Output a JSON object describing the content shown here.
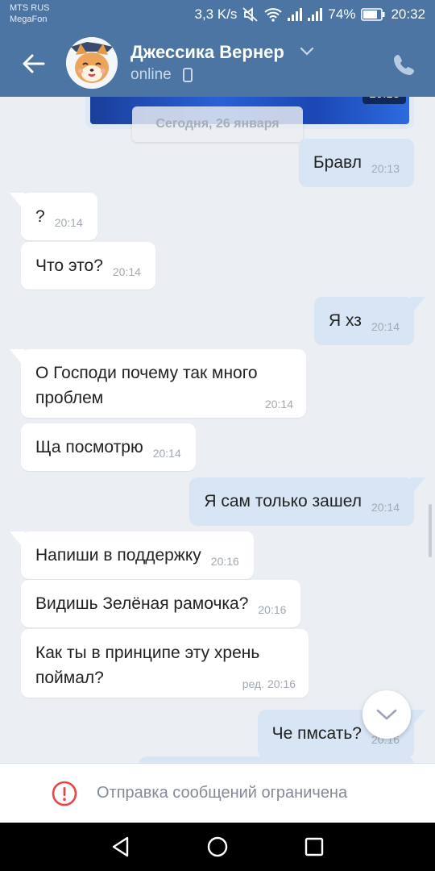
{
  "status_bar": {
    "carrier1": "MTS RUS",
    "carrier2": "MegaFon",
    "net_speed": "3,3 K/s",
    "battery": "74%",
    "time": "20:32"
  },
  "header": {
    "name": "Джессика Вернер",
    "status": "online",
    "icons": [
      "back-arrow-icon",
      "chevron-down-icon",
      "mobile-phone-icon",
      "phone-call-icon"
    ]
  },
  "chat": {
    "media_time": "20:13",
    "date_divider": "Сегодня, 26 января",
    "messages": [
      {
        "dir": "out",
        "text": "Бравл",
        "time": "20:13"
      },
      {
        "dir": "in",
        "text": "?",
        "time": "20:14"
      },
      {
        "dir": "in",
        "text": "Что это?",
        "time": "20:14"
      },
      {
        "dir": "out",
        "text": "Я хз",
        "time": "20:14"
      },
      {
        "dir": "in",
        "text": "О Господи почему так много проблем",
        "time": "20:14"
      },
      {
        "dir": "in",
        "text": "Ща посмотрю",
        "time": "20:14"
      },
      {
        "dir": "out",
        "text": "Я сам только зашел",
        "time": "20:14"
      },
      {
        "dir": "in",
        "text": "Напиши в поддержку",
        "time": "20:16"
      },
      {
        "dir": "in",
        "text": "Видишь Зелёная рамочка?",
        "time": "20:16"
      },
      {
        "dir": "in",
        "text": "Как ты в принципе эту хрень поймал?",
        "time": "ред. 20:16"
      },
      {
        "dir": "out",
        "text": "Че пмсать?",
        "time": "20:16"
      }
    ]
  },
  "footer": {
    "restriction_text": "Отправка сообщений ограничена"
  },
  "colors": {
    "header_bg": "#4c75a3",
    "chat_bg": "#ebeef2",
    "outgoing_bubble": "#d8e5f5",
    "incoming_bubble": "#ffffff",
    "warning_red": "#e64646"
  }
}
